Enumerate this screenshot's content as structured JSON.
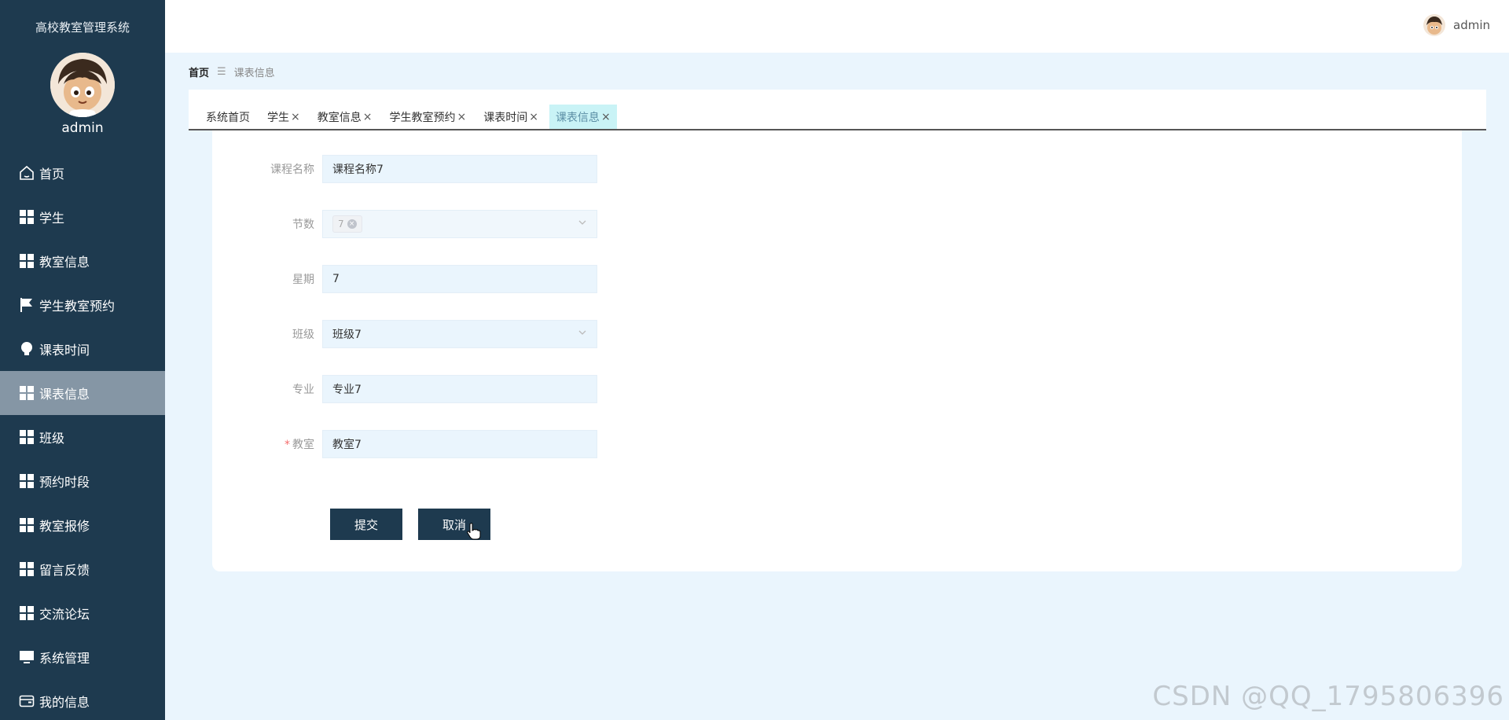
{
  "sidebar": {
    "system_title": "高校教室管理系统",
    "username": "admin",
    "items": [
      {
        "label": "首页",
        "icon": "home-icon"
      },
      {
        "label": "学生",
        "icon": "grid-icon"
      },
      {
        "label": "教室信息",
        "icon": "grid-icon"
      },
      {
        "label": "学生教室预约",
        "icon": "flag-icon"
      },
      {
        "label": "课表时间",
        "icon": "bulb-icon"
      },
      {
        "label": "课表信息",
        "icon": "grid-icon",
        "active": true
      },
      {
        "label": "班级",
        "icon": "grid-icon"
      },
      {
        "label": "预约时段",
        "icon": "grid-icon"
      },
      {
        "label": "教室报修",
        "icon": "grid-icon"
      },
      {
        "label": "留言反馈",
        "icon": "grid-icon"
      },
      {
        "label": "交流论坛",
        "icon": "grid-icon"
      },
      {
        "label": "系统管理",
        "icon": "monitor-icon"
      },
      {
        "label": "我的信息",
        "icon": "wallet-icon"
      }
    ]
  },
  "header": {
    "username": "admin"
  },
  "breadcrumb": {
    "home": "首页",
    "separator": "☰",
    "current": "课表信息"
  },
  "tabs": [
    {
      "label": "系统首页",
      "closable": false
    },
    {
      "label": "学生",
      "closable": true
    },
    {
      "label": "教室信息",
      "closable": true
    },
    {
      "label": "学生教室预约",
      "closable": true
    },
    {
      "label": "课表时间",
      "closable": true
    },
    {
      "label": "课表信息",
      "closable": true,
      "active": true
    }
  ],
  "form": {
    "course_name": {
      "label": "课程名称",
      "value": "课程名称7"
    },
    "section_count": {
      "label": "节数",
      "value": "7"
    },
    "weekday": {
      "label": "星期",
      "value": "7"
    },
    "class": {
      "label": "班级",
      "value": "班级7"
    },
    "major": {
      "label": "专业",
      "value": "专业7"
    },
    "classroom": {
      "label": "教室",
      "value": "教室7",
      "required": true
    }
  },
  "buttons": {
    "submit": "提交",
    "cancel": "取消"
  },
  "watermark": "CSDN @QQ_1795806396",
  "colors": {
    "sidebar_bg": "#1e3a4f",
    "active_item": "#8596a5",
    "page_bg": "#eaf5fd",
    "active_tab": "#c9f3f6"
  }
}
